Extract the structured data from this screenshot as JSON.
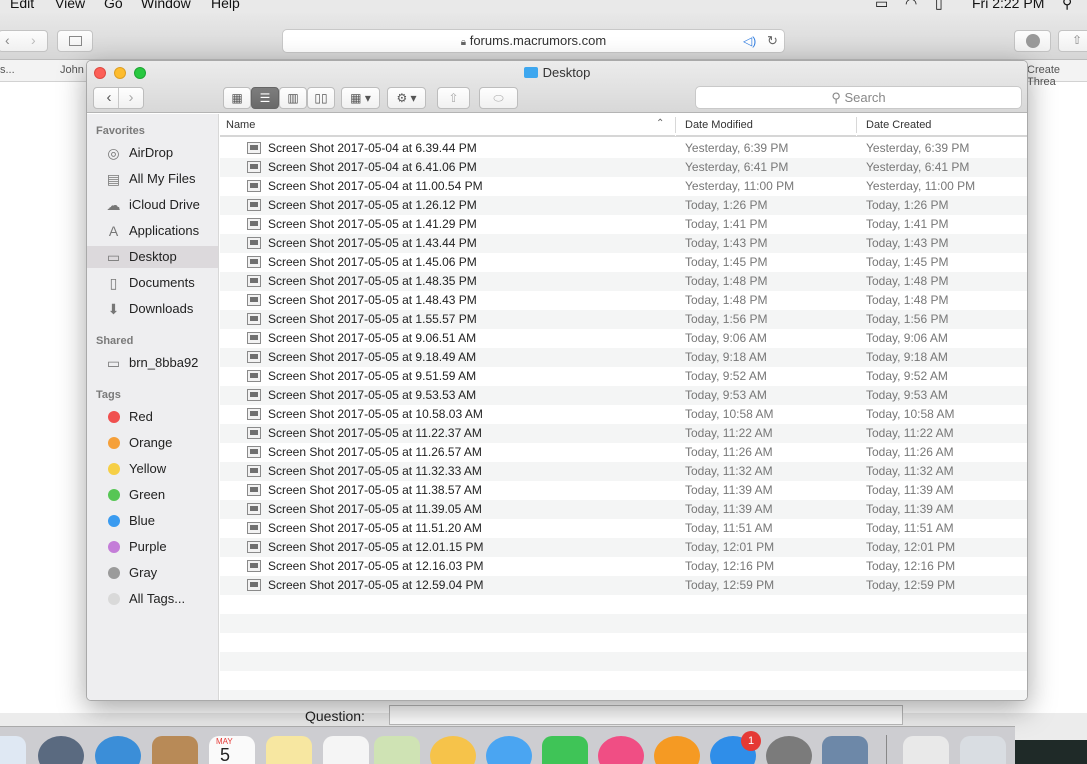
{
  "menubar": {
    "items": [
      "Edit",
      "View",
      "Go",
      "Window",
      "Help"
    ],
    "clock": "Fri 2:22 PM"
  },
  "safari": {
    "url": "forums.macrumors.com",
    "bookmarks": [
      "s...",
      "John",
      "Create Threa"
    ],
    "question_label": "Question:"
  },
  "finder": {
    "title": "Desktop",
    "search_placeholder": "Search",
    "sidebar": {
      "favorites_header": "Favorites",
      "favorites": [
        {
          "label": "AirDrop",
          "icon": "airdrop-icon"
        },
        {
          "label": "All My Files",
          "icon": "all-files-icon"
        },
        {
          "label": "iCloud Drive",
          "icon": "cloud-icon"
        },
        {
          "label": "Applications",
          "icon": "applications-icon"
        },
        {
          "label": "Desktop",
          "icon": "desktop-icon",
          "selected": true
        },
        {
          "label": "Documents",
          "icon": "documents-icon"
        },
        {
          "label": "Downloads",
          "icon": "downloads-icon"
        }
      ],
      "shared_header": "Shared",
      "shared": [
        {
          "label": "brn_8bba92",
          "icon": "computer-icon"
        }
      ],
      "tags_header": "Tags",
      "tags": [
        {
          "label": "Red",
          "color": "#f0504f"
        },
        {
          "label": "Orange",
          "color": "#f5a03a"
        },
        {
          "label": "Yellow",
          "color": "#f6cf46"
        },
        {
          "label": "Green",
          "color": "#57c655"
        },
        {
          "label": "Blue",
          "color": "#3a9bf0"
        },
        {
          "label": "Purple",
          "color": "#c47dd8"
        },
        {
          "label": "Gray",
          "color": "#9b9b9b"
        },
        {
          "label": "All Tags...",
          "color": "#d9d9d9"
        }
      ]
    },
    "columns": {
      "name": "Name",
      "modified": "Date Modified",
      "created": "Date Created"
    },
    "files": [
      {
        "name": "Screen Shot 2017-05-04 at 6.39.44 PM",
        "modified": "Yesterday, 6:39 PM",
        "created": "Yesterday, 6:39 PM"
      },
      {
        "name": "Screen Shot 2017-05-04 at 6.41.06 PM",
        "modified": "Yesterday, 6:41 PM",
        "created": "Yesterday, 6:41 PM"
      },
      {
        "name": "Screen Shot 2017-05-04 at 11.00.54 PM",
        "modified": "Yesterday, 11:00 PM",
        "created": "Yesterday, 11:00 PM"
      },
      {
        "name": "Screen Shot 2017-05-05 at 1.26.12 PM",
        "modified": "Today, 1:26 PM",
        "created": "Today, 1:26 PM"
      },
      {
        "name": "Screen Shot 2017-05-05 at 1.41.29 PM",
        "modified": "Today, 1:41 PM",
        "created": "Today, 1:41 PM"
      },
      {
        "name": "Screen Shot 2017-05-05 at 1.43.44 PM",
        "modified": "Today, 1:43 PM",
        "created": "Today, 1:43 PM"
      },
      {
        "name": "Screen Shot 2017-05-05 at 1.45.06 PM",
        "modified": "Today, 1:45 PM",
        "created": "Today, 1:45 PM"
      },
      {
        "name": "Screen Shot 2017-05-05 at 1.48.35 PM",
        "modified": "Today, 1:48 PM",
        "created": "Today, 1:48 PM"
      },
      {
        "name": "Screen Shot 2017-05-05 at 1.48.43 PM",
        "modified": "Today, 1:48 PM",
        "created": "Today, 1:48 PM"
      },
      {
        "name": "Screen Shot 2017-05-05 at 1.55.57 PM",
        "modified": "Today, 1:56 PM",
        "created": "Today, 1:56 PM"
      },
      {
        "name": "Screen Shot 2017-05-05 at 9.06.51 AM",
        "modified": "Today, 9:06 AM",
        "created": "Today, 9:06 AM"
      },
      {
        "name": "Screen Shot 2017-05-05 at 9.18.49 AM",
        "modified": "Today, 9:18 AM",
        "created": "Today, 9:18 AM"
      },
      {
        "name": "Screen Shot 2017-05-05 at 9.51.59 AM",
        "modified": "Today, 9:52 AM",
        "created": "Today, 9:52 AM"
      },
      {
        "name": "Screen Shot 2017-05-05 at 9.53.53 AM",
        "modified": "Today, 9:53 AM",
        "created": "Today, 9:53 AM"
      },
      {
        "name": "Screen Shot 2017-05-05 at 10.58.03 AM",
        "modified": "Today, 10:58 AM",
        "created": "Today, 10:58 AM"
      },
      {
        "name": "Screen Shot 2017-05-05 at 11.22.37 AM",
        "modified": "Today, 11:22 AM",
        "created": "Today, 11:22 AM"
      },
      {
        "name": "Screen Shot 2017-05-05 at 11.26.57 AM",
        "modified": "Today, 11:26 AM",
        "created": "Today, 11:26 AM"
      },
      {
        "name": "Screen Shot 2017-05-05 at 11.32.33 AM",
        "modified": "Today, 11:32 AM",
        "created": "Today, 11:32 AM"
      },
      {
        "name": "Screen Shot 2017-05-05 at 11.38.57 AM",
        "modified": "Today, 11:39 AM",
        "created": "Today, 11:39 AM"
      },
      {
        "name": "Screen Shot 2017-05-05 at 11.39.05 AM",
        "modified": "Today, 11:39 AM",
        "created": "Today, 11:39 AM"
      },
      {
        "name": "Screen Shot 2017-05-05 at 11.51.20 AM",
        "modified": "Today, 11:51 AM",
        "created": "Today, 11:51 AM"
      },
      {
        "name": "Screen Shot 2017-05-05 at 12.01.15 PM",
        "modified": "Today, 12:01 PM",
        "created": "Today, 12:01 PM"
      },
      {
        "name": "Screen Shot 2017-05-05 at 12.16.03 PM",
        "modified": "Today, 12:16 PM",
        "created": "Today, 12:16 PM"
      },
      {
        "name": "Screen Shot 2017-05-05 at 12.59.04 PM",
        "modified": "Today, 12:59 PM",
        "created": "Today, 12:59 PM"
      }
    ]
  },
  "dock": {
    "calendar_month": "MAY",
    "calendar_day": "5",
    "app_store_badge": "1"
  }
}
